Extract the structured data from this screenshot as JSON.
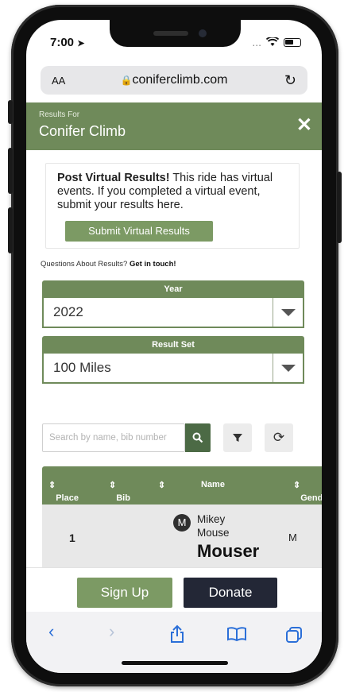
{
  "status_bar": {
    "time": "7:00",
    "signal": "...",
    "wifi": "wifi-icon",
    "battery": "battery-icon"
  },
  "browser": {
    "text_size": "AA",
    "url": "coniferclimb.com"
  },
  "header": {
    "small": "Results For",
    "title": "Conifer Climb",
    "close": "✕"
  },
  "virtual": {
    "heading": "Post Virtual Results!",
    "text": "This ride has virtual events. If you completed a virtual event, submit your results here.",
    "button": "Submit Virtual Results"
  },
  "questions": {
    "text": "Questions About Results?",
    "link": "Get in touch!"
  },
  "year": {
    "label": "Year",
    "value": "2022"
  },
  "result_set": {
    "label": "Result Set",
    "value": "100 Miles"
  },
  "search": {
    "placeholder": "Search by name, bib number"
  },
  "table": {
    "headers": [
      "Place",
      "Bib",
      "",
      "Name",
      "Gender"
    ],
    "rows": [
      {
        "place": "1",
        "first": "Mikey",
        "last": "Mouse",
        "team": "Mouser",
        "gender": "M",
        "initial": "M"
      }
    ]
  },
  "actions": {
    "signup": "Sign Up",
    "donate": "Donate"
  },
  "icons": {
    "filter": "filter-icon",
    "refresh": "refresh-icon",
    "back": "chevron-left-icon",
    "forward": "chevron-right-icon",
    "share": "share-icon",
    "bookmarks": "book-icon",
    "tabs": "tabs-icon"
  },
  "colors": {
    "brand_green": "#6f8a5a",
    "button_green": "#7c9a64",
    "donate_navy": "#232736",
    "search_green": "#4c6a45"
  }
}
